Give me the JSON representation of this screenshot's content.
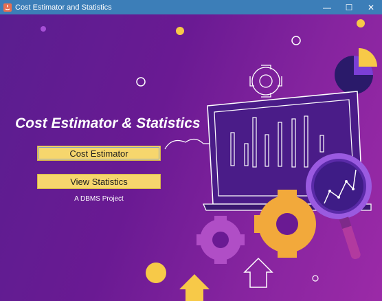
{
  "window": {
    "title": "Cost Estimator and Statistics",
    "controls": [
      "—",
      "☐",
      "✕"
    ]
  },
  "main": {
    "headline": "Cost Estimator & Statistics",
    "primary_button": "Cost Estimator",
    "secondary_button": "View Statistics",
    "subtitle": "A DBMS Project"
  },
  "colors": {
    "titlebar": "#3c7eb8",
    "background_start": "#5a1e90",
    "background_end": "#9b2aa7",
    "button_fill": "#f6d66d",
    "accent_yellow": "#f7c948",
    "accent_orange": "#f2a93b"
  }
}
